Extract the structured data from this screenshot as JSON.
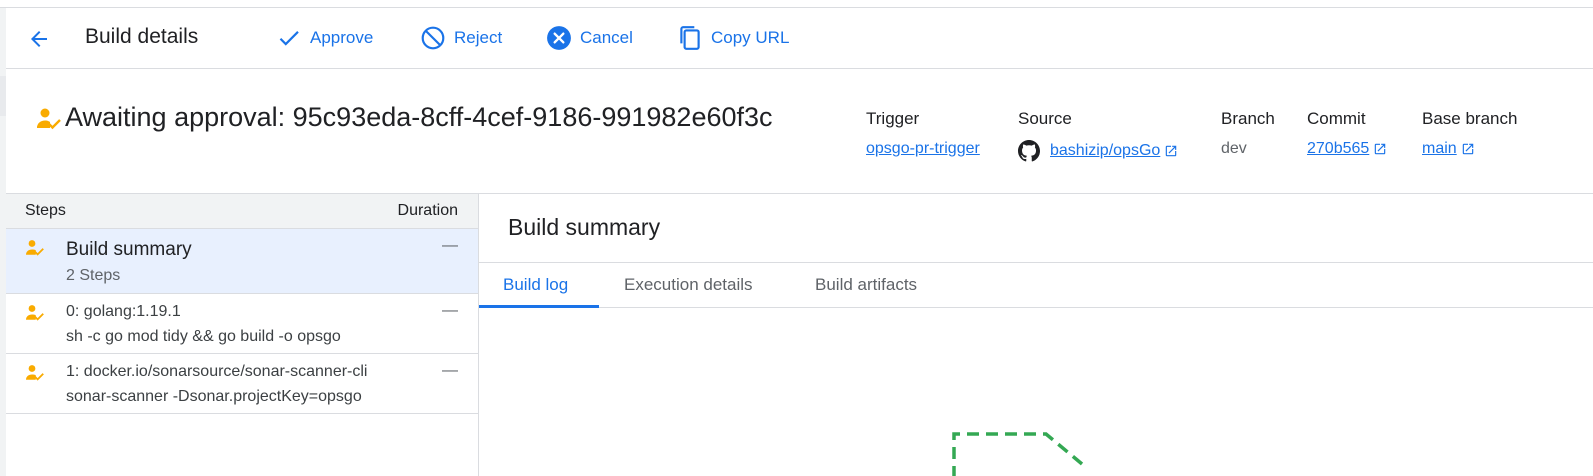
{
  "toolbar": {
    "title": "Build details",
    "actions": [
      {
        "label": "Approve",
        "icon": "check-icon"
      },
      {
        "label": "Reject",
        "icon": "block-icon"
      },
      {
        "label": "Cancel",
        "icon": "cancel-circle-icon"
      },
      {
        "label": "Copy URL",
        "icon": "copy-icon"
      }
    ]
  },
  "build": {
    "status": "awaiting-approval",
    "heading": "Awaiting approval: 95c93eda-8cff-4cef-9186-991982e60f3c"
  },
  "meta": {
    "trigger": {
      "label": "Trigger",
      "value": "opsgo-pr-trigger"
    },
    "source": {
      "label": "Source",
      "value": "bashizip/opsGo",
      "icon": "github-icon"
    },
    "branch": {
      "label": "Branch",
      "value": "dev"
    },
    "commit": {
      "label": "Commit",
      "value": "270b565"
    },
    "base_branch": {
      "label": "Base branch",
      "value": "main"
    }
  },
  "steps_table": {
    "columns": {
      "steps": "Steps",
      "duration": "Duration"
    },
    "rows": [
      {
        "title": "Build summary",
        "subtitle": "2 Steps",
        "duration": "—",
        "selected": true
      },
      {
        "title": "0: golang:1.19.1",
        "subtitle": "sh -c go mod tidy && go build -o opsgo",
        "duration": "—"
      },
      {
        "title": "1: docker.io/sonarsource/sonar-scanner-cli",
        "subtitle": "sonar-scanner -Dsonar.projectKey=opsgo",
        "duration": "—"
      }
    ]
  },
  "main": {
    "title": "Build summary",
    "tabs": [
      {
        "label": "Build log",
        "active": true
      },
      {
        "label": "Execution details"
      },
      {
        "label": "Build artifacts"
      }
    ]
  },
  "colors": {
    "accent": "#1a73e8",
    "awaiting": "#f9ab00",
    "placeholder": "#34a853"
  }
}
